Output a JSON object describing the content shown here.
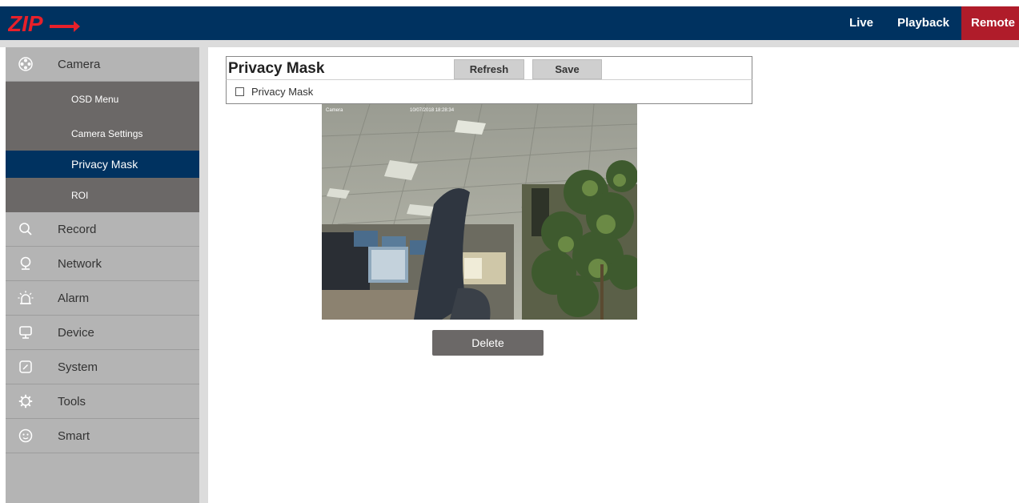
{
  "header": {
    "logo_text": "ZIP",
    "nav": [
      "Live",
      "Playback",
      "Remote"
    ]
  },
  "sidebar": {
    "camera": {
      "label": "Camera",
      "icon": "camera-reel-icon",
      "subitems": [
        "OSD Menu",
        "Camera Settings",
        "Privacy Mask",
        "ROI"
      ],
      "active": "Privacy Mask"
    },
    "items": [
      {
        "label": "Record",
        "icon": "search-icon"
      },
      {
        "label": "Network",
        "icon": "globe-pin-icon"
      },
      {
        "label": "Alarm",
        "icon": "alarm-light-icon"
      },
      {
        "label": "Device",
        "icon": "monitor-icon"
      },
      {
        "label": "System",
        "icon": "gauge-icon"
      },
      {
        "label": "Tools",
        "icon": "gear-icon"
      },
      {
        "label": "Smart",
        "icon": "smart-face-icon"
      }
    ]
  },
  "panel": {
    "title": "Privacy Mask",
    "refresh_label": "Refresh",
    "save_label": "Save",
    "checkbox_label": "Privacy Mask",
    "checkbox_checked": false
  },
  "camera_view": {
    "osd_name": "Camera",
    "osd_timestamp": "10/07/2018 18:28:34"
  },
  "delete_label": "Delete",
  "colors": {
    "topbar": "#003260",
    "remote_tab": "#b01c2a",
    "sidebar": "#b4b4b4",
    "submenu": "#6b6867",
    "active_item": "#003260"
  }
}
